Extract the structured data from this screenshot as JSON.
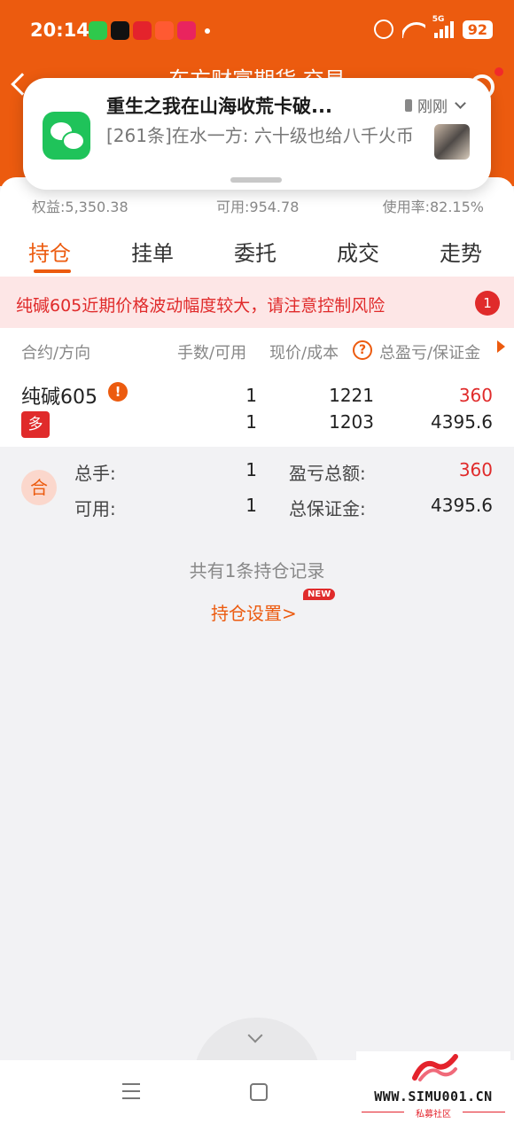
{
  "status_bar": {
    "time": "20:14",
    "network": "5G",
    "battery": "92"
  },
  "header": {
    "title": "东方财富期货 交易"
  },
  "notification": {
    "title": "重生之我在山海收荒卡破...",
    "body": "[261条]在水一方: 六十级也给八千火币",
    "time": "刚刚"
  },
  "summary": {
    "equity": "权益:5,350.38",
    "available": "可用:954.78",
    "usage": "使用率:82.15%"
  },
  "tabs": [
    {
      "label": "持仓",
      "active": true
    },
    {
      "label": "挂单",
      "active": false
    },
    {
      "label": "委托",
      "active": false
    },
    {
      "label": "成交",
      "active": false
    },
    {
      "label": "走势",
      "active": false
    }
  ],
  "warning": {
    "text": "纯碱605近期价格波动幅度较大，请注意控制风险",
    "count": "1"
  },
  "table": {
    "headers": {
      "contract": "合约/方向",
      "lots": "手数/可用",
      "price": "现价/成本",
      "help": "?",
      "pnl": "总盈亏/保证金"
    },
    "rows": [
      {
        "name": "纯碱605",
        "alert": "!",
        "direction": "多",
        "lots": "1",
        "available": "1",
        "price": "1221",
        "cost": "1203",
        "pnl": "360",
        "margin": "4395.6"
      }
    ]
  },
  "totals": {
    "badge": "合",
    "total_lots_label": "总手:",
    "total_lots": "1",
    "available_label": "可用:",
    "available": "1",
    "pnl_label": "盈亏总额:",
    "pnl": "360",
    "margin_label": "总保证金:",
    "margin": "4395.6"
  },
  "footer": {
    "records": "共有1条持仓记录",
    "settings_link": "持仓设置>",
    "new_badge": "NEW"
  },
  "watermark": {
    "site": "WWW.SIMU001.CN",
    "sub": "私募社区"
  },
  "colors": {
    "brand_orange": "#ec5b0f",
    "loss_red": "#e02b2b",
    "warning_bg": "#fde6e6"
  }
}
